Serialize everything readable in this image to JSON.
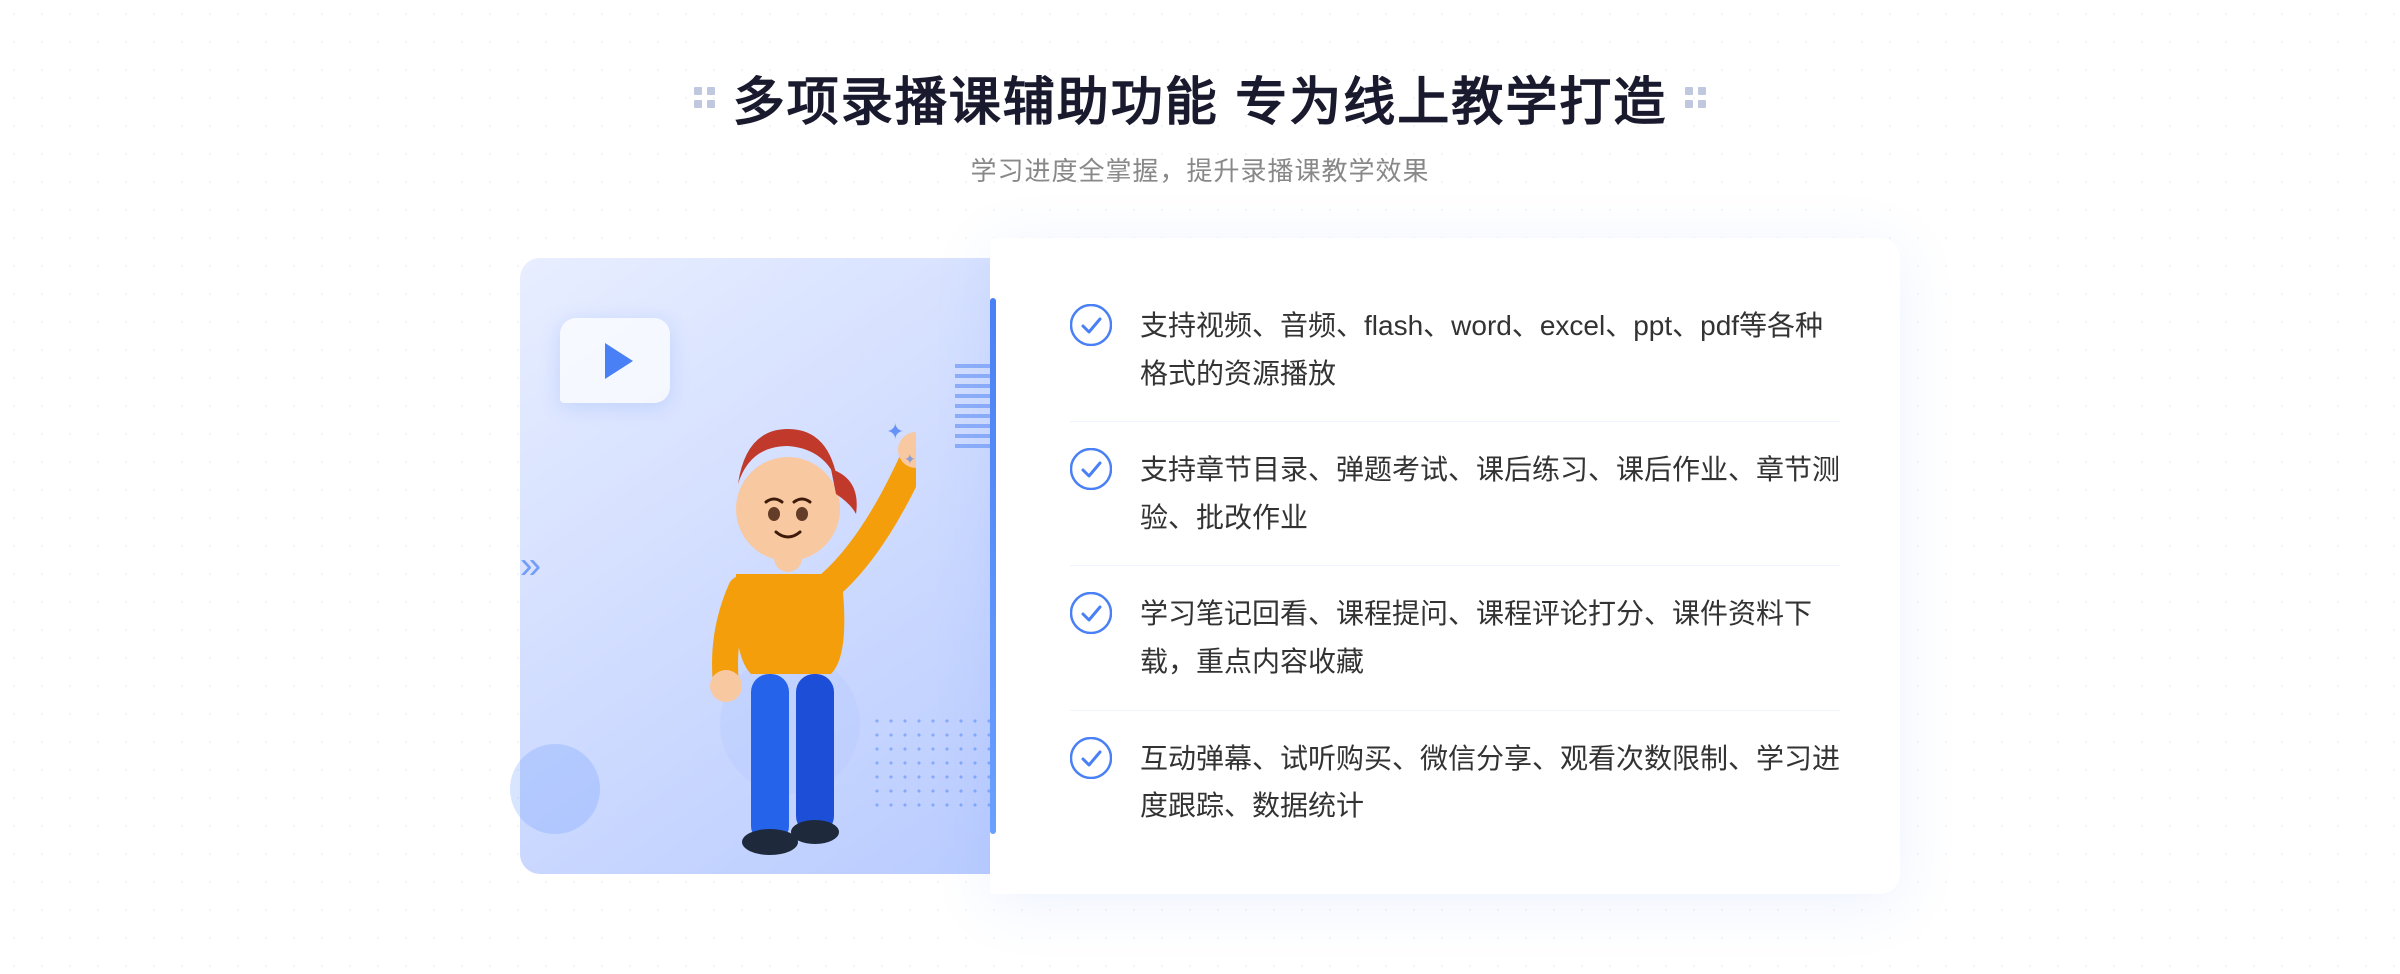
{
  "header": {
    "title_main": "多项录播课辅助功能 专为线上教学打造",
    "title_sub": "学习进度全掌握，提升录播课教学效果"
  },
  "features": [
    {
      "id": "feature-1",
      "text": "支持视频、音频、flash、word、excel、ppt、pdf等各种格式的资源播放"
    },
    {
      "id": "feature-2",
      "text": "支持章节目录、弹题考试、课后练习、课后作业、章节测验、批改作业"
    },
    {
      "id": "feature-3",
      "text": "学习笔记回看、课程提问、课程评论打分、课件资料下载，重点内容收藏"
    },
    {
      "id": "feature-4",
      "text": "互动弹幕、试听购买、微信分享、观看次数限制、学习进度跟踪、数据统计"
    }
  ],
  "colors": {
    "primary_blue": "#4a80f5",
    "light_blue": "#e8eeff",
    "text_dark": "#1a1a2e",
    "text_gray": "#888888"
  }
}
